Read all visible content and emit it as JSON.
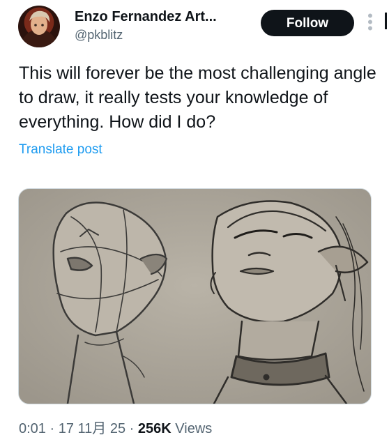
{
  "author": {
    "display_name": "Enzo Fernandez Art...",
    "handle": "@pkblitz",
    "avatar_icon": "user-avatar"
  },
  "actions": {
    "follow_label": "Follow",
    "more_icon": "more-vertical-icon"
  },
  "post": {
    "text": "This will forever be the most challenging angle to draw, it really tests your knowledge of everything. How did I do?",
    "translate_label": "Translate post",
    "media_description": "pencil sketch of two upturned heads"
  },
  "meta": {
    "time": "0:01",
    "date": "17 11月 25",
    "views_count": "256K",
    "views_label": "Views",
    "sep": "·"
  },
  "colors": {
    "link": "#1d9bf0",
    "secondary_text": "#536471",
    "button_bg": "#0f1419"
  }
}
